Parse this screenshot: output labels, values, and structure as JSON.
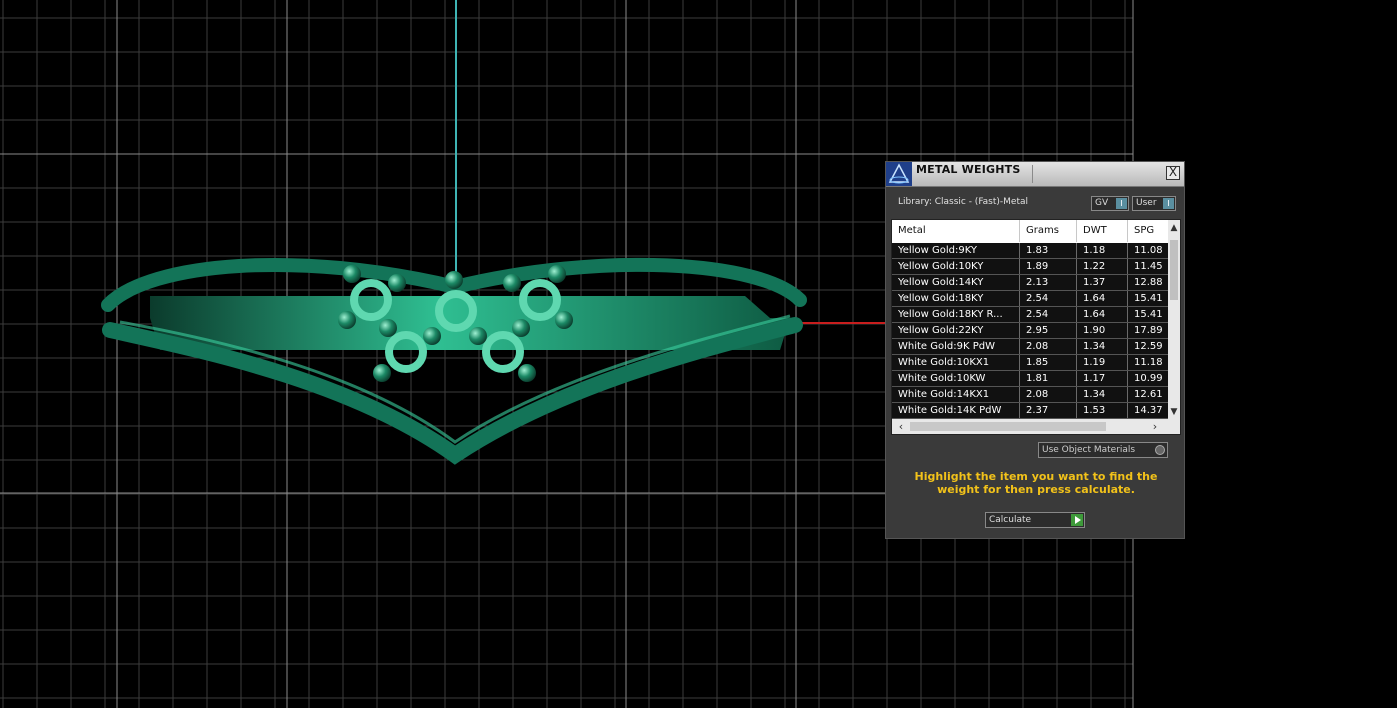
{
  "panel": {
    "title": "METAL WEIGHTS",
    "close_label": "X",
    "library_label": "Library: Classic - (Fast)-Metal",
    "toggles": [
      {
        "label": "GV",
        "state": "I"
      },
      {
        "label": "User",
        "state": "I"
      }
    ],
    "table": {
      "columns": [
        "Metal",
        "Grams",
        "DWT",
        "SPG"
      ],
      "rows": [
        [
          "Yellow Gold:9KY",
          "1.83",
          "1.18",
          "11.08"
        ],
        [
          "Yellow Gold:10KY",
          "1.89",
          "1.22",
          "11.45"
        ],
        [
          "Yellow Gold:14KY",
          "2.13",
          "1.37",
          "12.88"
        ],
        [
          "Yellow Gold:18KY",
          "2.54",
          "1.64",
          "15.41"
        ],
        [
          "Yellow Gold:18KY R...",
          "2.54",
          "1.64",
          "15.41"
        ],
        [
          "Yellow Gold:22KY",
          "2.95",
          "1.90",
          "17.89"
        ],
        [
          "White Gold:9K PdW",
          "2.08",
          "1.34",
          "12.59"
        ],
        [
          "White Gold:10KX1",
          "1.85",
          "1.19",
          "11.18"
        ],
        [
          "White Gold:10KW",
          "1.81",
          "1.17",
          "10.99"
        ],
        [
          "White Gold:14KX1",
          "2.08",
          "1.34",
          "12.61"
        ],
        [
          "White Gold:14K PdW",
          "2.37",
          "1.53",
          "14.37"
        ]
      ]
    },
    "use_materials_label": "Use Object Materials",
    "hint": "Highlight the item you want to find the weight for then press calculate.",
    "calculate_label": "Calculate"
  }
}
